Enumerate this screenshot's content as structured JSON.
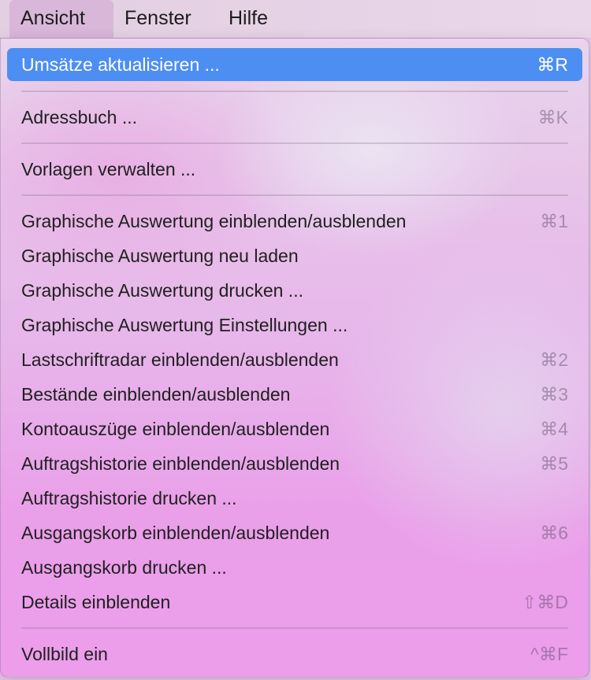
{
  "menubar": {
    "items": [
      "Ansicht",
      "Fenster",
      "Hilfe"
    ]
  },
  "menu": {
    "items": [
      {
        "label": "Umsätze aktualisieren ...",
        "shortcut": "⌘R"
      },
      {
        "label": "Adressbuch ...",
        "shortcut": "⌘K"
      },
      {
        "label": "Vorlagen verwalten ...",
        "shortcut": ""
      },
      {
        "label": "Graphische Auswertung einblenden/ausblenden",
        "shortcut": "⌘1"
      },
      {
        "label": "Graphische Auswertung neu laden",
        "shortcut": ""
      },
      {
        "label": "Graphische Auswertung drucken ...",
        "shortcut": ""
      },
      {
        "label": "Graphische Auswertung Einstellungen ...",
        "shortcut": ""
      },
      {
        "label": "Lastschriftradar einblenden/ausblenden",
        "shortcut": "⌘2"
      },
      {
        "label": "Bestände einblenden/ausblenden",
        "shortcut": "⌘3"
      },
      {
        "label": "Kontoauszüge einblenden/ausblenden",
        "shortcut": "⌘4"
      },
      {
        "label": "Auftragshistorie einblenden/ausblenden",
        "shortcut": "⌘5"
      },
      {
        "label": "Auftragshistorie drucken ...",
        "shortcut": ""
      },
      {
        "label": "Ausgangskorb einblenden/ausblenden",
        "shortcut": "⌘6"
      },
      {
        "label": "Ausgangskorb drucken ...",
        "shortcut": ""
      },
      {
        "label": "Details einblenden",
        "shortcut": "⇧⌘D"
      },
      {
        "label": "Vollbild ein",
        "shortcut": "^⌘F"
      }
    ]
  },
  "colors": {
    "highlight": "#4d8ef3",
    "text": "#202020",
    "shortcut": "#9a8fa3"
  }
}
